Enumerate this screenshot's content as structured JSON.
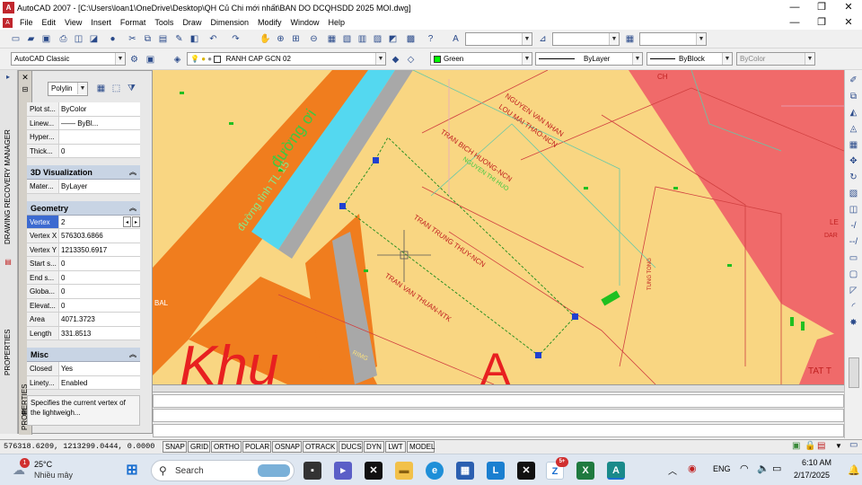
{
  "window": {
    "title": "AutoCAD 2007 - [C:\\Users\\loan1\\OneDrive\\Desktop\\QH Củ Chi mới nhất\\BAN DO DCQHSDD 2025 MOI.dwg]",
    "app_icon": "A"
  },
  "menu": [
    "File",
    "Edit",
    "View",
    "Insert",
    "Format",
    "Tools",
    "Draw",
    "Dimension",
    "Modify",
    "Window",
    "Help"
  ],
  "toolbar2": {
    "workspace": "AutoCAD Classic",
    "layer": "RANH CAP GCN 02",
    "color": "Green",
    "linetype": "ByLayer",
    "lineweight": "ByBlock",
    "plotstyle": "ByColor",
    "colors": {
      "layer_swatch": "#ffffff",
      "green": "#00ff00"
    }
  },
  "side_strip": {
    "label1": "DRAWING RECOVERY MANAGER",
    "label2": "PROPERTIES"
  },
  "palette": {
    "title": "PROPERTIES",
    "object_type": "Polylin",
    "general_rows": [
      {
        "k": "Plot st...",
        "v": "ByColor"
      },
      {
        "k": "Linew...",
        "v": "—— ByBl..."
      },
      {
        "k": "Hyper...",
        "v": ""
      },
      {
        "k": "Thick...",
        "v": "0"
      }
    ],
    "sections": {
      "viz": "3D Visualization",
      "geom": "Geometry",
      "misc": "Misc"
    },
    "viz_rows": [
      {
        "k": "Mater...",
        "v": "ByLayer"
      }
    ],
    "geom_rows": [
      {
        "k": "Vertex",
        "v": "2"
      },
      {
        "k": "Vertex X",
        "v": "576303.6866"
      },
      {
        "k": "Vertex Y",
        "v": "1213350.6917"
      },
      {
        "k": "Start s...",
        "v": "0"
      },
      {
        "k": "End s...",
        "v": "0"
      },
      {
        "k": "Globa...",
        "v": "0"
      },
      {
        "k": "Elevat...",
        "v": "0"
      },
      {
        "k": "Area",
        "v": "4071.3723"
      },
      {
        "k": "Length",
        "v": "331.8513"
      }
    ],
    "misc_rows": [
      {
        "k": "Closed",
        "v": "Yes"
      },
      {
        "k": "Linety...",
        "v": "Enabled"
      }
    ],
    "help": "Specifies the current vertex of the lightweigh..."
  },
  "drawing": {
    "road_label": "đường tỉnh TL 15",
    "road_label2": "đường ơi",
    "labels": {
      "l1": "NGUYEN VAN NHAN",
      "l2": "LOU MAI THAO-NCN",
      "l3": "TRAN BICH HUONG-NCN",
      "l4": "TRAN TRUNG THUY-NCN",
      "l5": "TRAN VAN THUAN-NTK",
      "l6": "TAT T",
      "l7": "BAL",
      "l8": "RIMG",
      "l9": "LE",
      "l10": "DAR",
      "l11": "CH",
      "l12": "TUNG TONG",
      "l13": "NGUYEN THI HUO"
    }
  },
  "statusbar": {
    "coords": "576318.6209, 1213299.0444, 0.0000",
    "buttons": [
      "SNAP",
      "GRID",
      "ORTHO",
      "POLAR",
      "OSNAP",
      "OTRACK",
      "DUCS",
      "DYN",
      "LWT",
      "MODEL"
    ]
  },
  "taskbar": {
    "weather_temp": "25°C",
    "weather_desc": "Nhiều mây",
    "weather_badge": "1",
    "search": "Search",
    "lang": "ENG",
    "time": "6:10 AM",
    "date": "2/17/2025",
    "notif_badge": "5+",
    "icons": [
      "start-icon",
      "search-icon",
      "video-app-icon",
      "meet-icon",
      "capcut-icon",
      "file-explorer-icon",
      "edge-icon",
      "store-icon",
      "lark-icon",
      "capcut2-icon",
      "zalo-icon",
      "excel-icon",
      "autocad-icon"
    ]
  }
}
